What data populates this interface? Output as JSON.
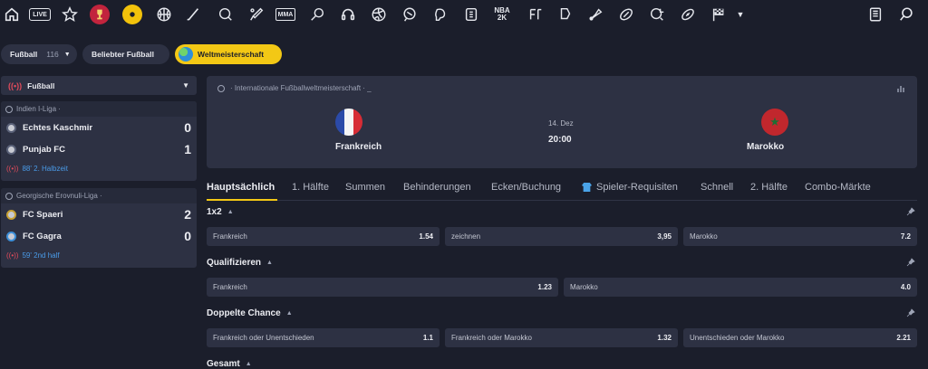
{
  "topbar": {
    "icons": [
      "home-icon",
      "live-icon",
      "star-icon",
      "world-cup-icon",
      "soccer-ball-icon",
      "basketball-icon",
      "hockey-stick-icon",
      "golf-icon",
      "cricket-icon",
      "mma-icon",
      "tennis-icon",
      "esports-headset-icon",
      "volleyball-icon",
      "table-tennis-icon",
      "boxing-icon",
      "darts-icon",
      "nba2k-icon",
      "fifa-icon",
      "ice-hockey-icon",
      "badminton-icon",
      "rugby-icon",
      "handball-icon",
      "american-football-icon",
      "racing-flag-icon",
      "more-icon"
    ],
    "live_label": "LIVE",
    "mma_label": "MMA",
    "nba_label": "NBA",
    "nba_sub": "2K"
  },
  "filters": {
    "sport": "Fußball",
    "sport_count": "116",
    "popular": "Beliebter Fußball",
    "active": "Weltmeisterschaft"
  },
  "left": {
    "sport_select": "Fußball",
    "leagues": [
      {
        "name": "Indien I-Liga ·",
        "teams": [
          {
            "name": "Echtes Kaschmir",
            "score": "0"
          },
          {
            "name": "Punjab FC",
            "score": "1"
          }
        ],
        "status": "88' 2. Halbzeit"
      },
      {
        "name": "Georgische Erovnuli-Liga ·",
        "teams": [
          {
            "name": "FC Spaeri",
            "score": "2"
          },
          {
            "name": "FC Gagra",
            "score": "0"
          }
        ],
        "status": "59' 2nd half"
      }
    ]
  },
  "match": {
    "breadcrumb": "· Internationale Fußballweltmeisterschaft · _",
    "home": "Frankreich",
    "away": "Marokko",
    "date": "14. Dez",
    "time": "20:00"
  },
  "tabs": [
    "Hauptsächlich",
    "1. Hälfte",
    "Summen",
    "Behinderungen",
    "Ecken/Buchung",
    "Spieler-Requisiten",
    "Schnell",
    "2. Hälfte",
    "Combo-Märkte"
  ],
  "markets": [
    {
      "title": "1x2",
      "odds": [
        {
          "label": "Frankreich",
          "value": "1.54"
        },
        {
          "label": "zeichnen",
          "value": "3,95"
        },
        {
          "label": "Marokko",
          "value": "7.2"
        }
      ]
    },
    {
      "title": "Qualifizieren",
      "odds": [
        {
          "label": "Frankreich",
          "value": "1.23"
        },
        {
          "label": "Marokko",
          "value": "4.0"
        }
      ]
    },
    {
      "title": "Doppelte Chance",
      "odds": [
        {
          "label": "Frankreich oder Unentschieden",
          "value": "1.1"
        },
        {
          "label": "Frankreich oder Marokko",
          "value": "1.32"
        },
        {
          "label": "Unentschieden oder Marokko",
          "value": "2.21"
        }
      ]
    },
    {
      "title": "Gesamt",
      "odds": []
    }
  ],
  "colors": {
    "accent": "#f3c815",
    "panel": "#2d3143",
    "bg": "#1b1e2b",
    "live": "#e24b5b",
    "link": "#4a9be8"
  }
}
